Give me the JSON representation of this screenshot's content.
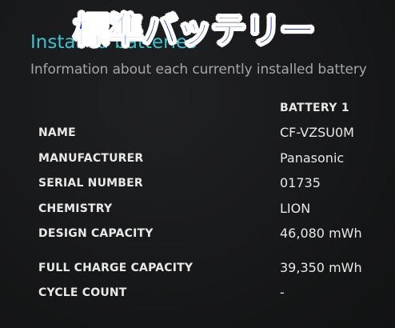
{
  "overlay": {
    "title": "標準バッテリー"
  },
  "section": {
    "title": "Installed batteries",
    "subtitle": "Information about each currently installed battery"
  },
  "table": {
    "column_header": "BATTERY 1",
    "rows": [
      {
        "label": "NAME",
        "value": "CF-VZSU0M"
      },
      {
        "label": "MANUFACTURER",
        "value": "Panasonic"
      },
      {
        "label": "SERIAL NUMBER",
        "value": "01735"
      },
      {
        "label": "CHEMISTRY",
        "value": "LION"
      },
      {
        "label": "DESIGN CAPACITY",
        "value": "46,080 mWh"
      },
      {
        "label": "FULL CHARGE CAPACITY",
        "value": "39,350 mWh"
      },
      {
        "label": "CYCLE COUNT",
        "value": "-"
      }
    ]
  },
  "colors": {
    "background": "#161718",
    "accent": "#3fc2cc",
    "overlay_text": "#0a2bd6",
    "overlay_outline": "#ffffff",
    "subtitle": "#a6a6a6",
    "text": "#e8e8e8"
  }
}
